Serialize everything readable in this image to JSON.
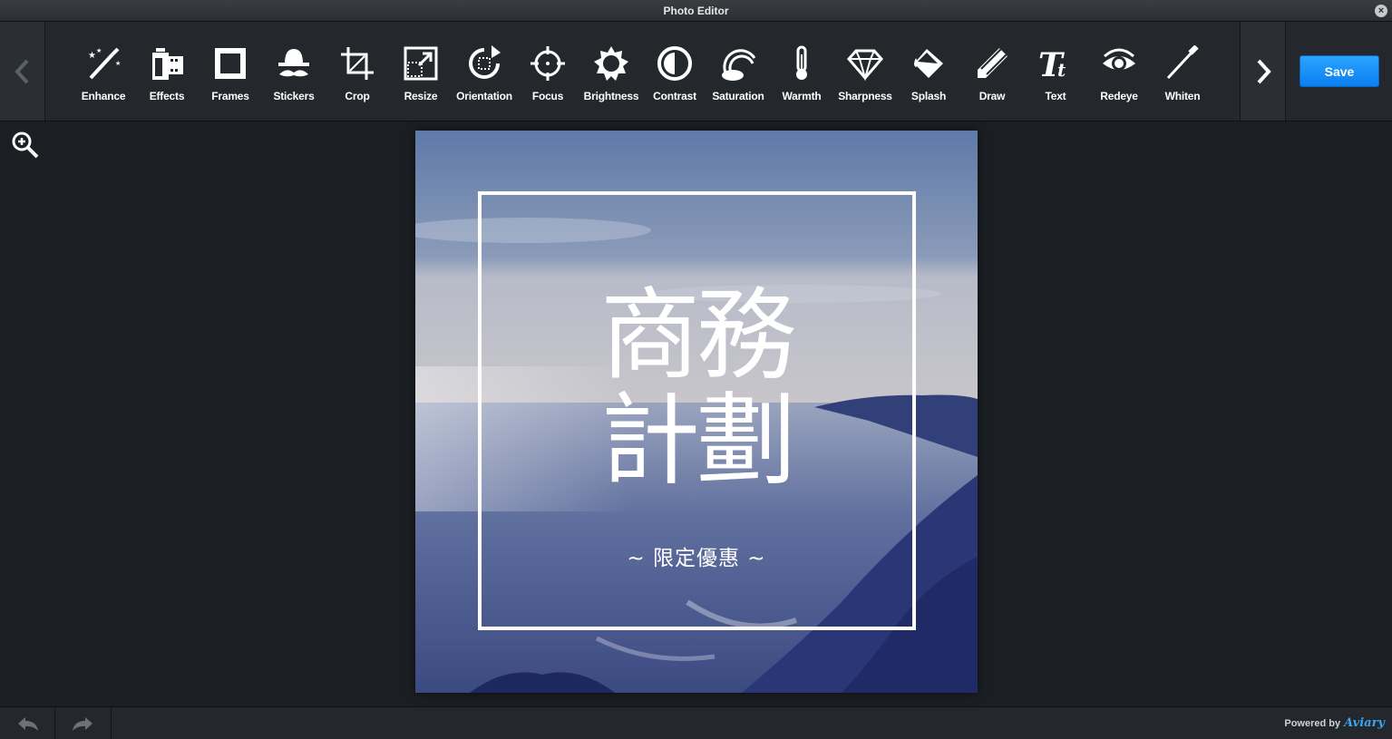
{
  "window": {
    "title": "Photo Editor",
    "close_glyph": "×"
  },
  "toolbar": {
    "tools": [
      {
        "label": "Enhance",
        "icon": "magic-wand-icon"
      },
      {
        "label": "Effects",
        "icon": "film-icon"
      },
      {
        "label": "Frames",
        "icon": "frame-icon"
      },
      {
        "label": "Stickers",
        "icon": "mustache-hat-icon"
      },
      {
        "label": "Crop",
        "icon": "crop-icon"
      },
      {
        "label": "Resize",
        "icon": "resize-icon"
      },
      {
        "label": "Orientation",
        "icon": "rotate-icon"
      },
      {
        "label": "Focus",
        "icon": "crosshair-icon"
      },
      {
        "label": "Brightness",
        "icon": "sun-icon"
      },
      {
        "label": "Contrast",
        "icon": "contrast-icon"
      },
      {
        "label": "Saturation",
        "icon": "rainbow-icon"
      },
      {
        "label": "Warmth",
        "icon": "thermometer-icon"
      },
      {
        "label": "Sharpness",
        "icon": "diamond-icon"
      },
      {
        "label": "Splash",
        "icon": "paint-bucket-icon"
      },
      {
        "label": "Draw",
        "icon": "pencil-icon"
      },
      {
        "label": "Text",
        "icon": "text-icon"
      },
      {
        "label": "Redeye",
        "icon": "eye-icon"
      },
      {
        "label": "Whiten",
        "icon": "toothbrush-icon"
      }
    ],
    "save_label": "Save"
  },
  "canvas": {
    "headline_line1": "商務",
    "headline_line2": "計劃",
    "subline": "~ 限定優惠 ~"
  },
  "footer": {
    "powered_by": "Powered by",
    "brand": "Aviary"
  },
  "colors": {
    "accent": "#1a8ff7",
    "background": "#1b1f23",
    "toolbar": "#24282d"
  }
}
